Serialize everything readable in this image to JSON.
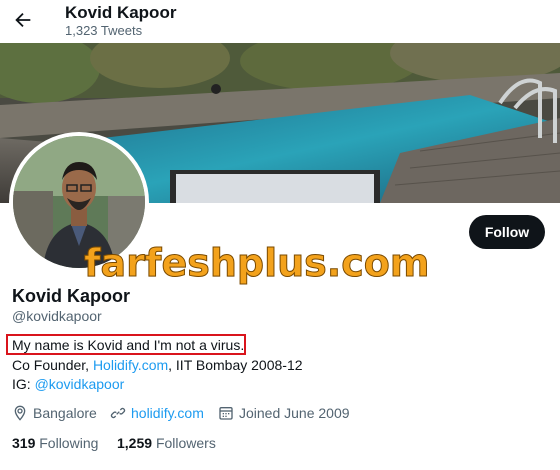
{
  "header": {
    "title": "Kovid Kapoor",
    "tweets_count": "1,323 Tweets"
  },
  "watermark": "farfeshplus.com",
  "profile": {
    "follow_label": "Follow",
    "name": "Kovid Kapoor",
    "handle": "@kovidkapoor",
    "bio": "My name is Kovid and I'm not a virus.",
    "line2_pre": "Co Founder, ",
    "line2_link": "Holidify.com",
    "line2_post": ", IIT Bombay 2008-12",
    "line3_pre": "IG: ",
    "line3_link": "@kovidkapoor",
    "location": "Bangalore",
    "website": "holidify.com",
    "joined": "Joined June 2009",
    "following_count": "319",
    "following_label": "Following",
    "followers_count": "1,259",
    "followers_label": "Followers"
  },
  "colors": {
    "link": "#1d9bf0",
    "highlight_box": "#d9141c",
    "follow_bg": "#0f1419"
  }
}
